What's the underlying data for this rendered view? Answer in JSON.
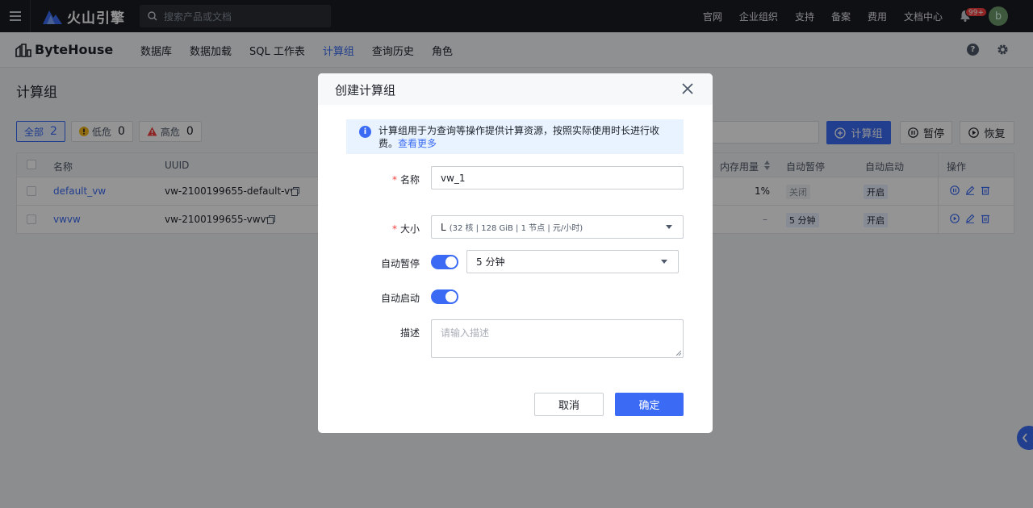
{
  "topbar": {
    "brand": "火山引擎",
    "search_placeholder": "搜索产品或文档",
    "links": [
      "官网",
      "企业组织",
      "支持",
      "备案",
      "费用",
      "文档中心"
    ],
    "notification_badge": "99+",
    "avatar_letter": "b"
  },
  "product": {
    "name": "ByteHouse",
    "tabs": [
      {
        "label": "数据库",
        "active": false
      },
      {
        "label": "数据加载",
        "active": false
      },
      {
        "label": "SQL 工作表",
        "active": false
      },
      {
        "label": "计算组",
        "active": true
      },
      {
        "label": "查询历史",
        "active": false
      },
      {
        "label": "角色",
        "active": false
      }
    ]
  },
  "page": {
    "title": "计算组",
    "filters": [
      {
        "label": "全部",
        "count": "2"
      },
      {
        "label": "低危",
        "count": "0"
      },
      {
        "label": "高危",
        "count": "0"
      }
    ],
    "actions": {
      "create": "计算组",
      "pause": "暂停",
      "resume": "恢复"
    }
  },
  "table": {
    "headers": {
      "name": "名称",
      "uuid": "UUID",
      "memory": "内存用量",
      "auto_pause": "自动暂停",
      "auto_start": "自动启动",
      "ops": "操作"
    },
    "rows": [
      {
        "name": "default_vw",
        "uuid": "vw-2100199655-default-vw",
        "memory": "1%",
        "auto_pause": "关闭",
        "auto_start": "开启"
      },
      {
        "name": "vwvw",
        "uuid": "vw-2100199655-vwvw",
        "memory": "–",
        "auto_pause": "5 分钟",
        "auto_start": "开启"
      }
    ]
  },
  "modal": {
    "title": "创建计算组",
    "info_text": "计算组用于为查询等操作提供计算资源，按照实际使用时长进行收费。",
    "info_link": "查看更多",
    "fields": {
      "name_label": "名称",
      "name_value": "vw_1",
      "size_label": "大小",
      "size_value": "L",
      "size_detail": "(32 核 | 128 GiB | 1 节点 | 元/小时)",
      "auto_pause_label": "自动暂停",
      "auto_pause_on": true,
      "auto_pause_value": "5 分钟",
      "auto_start_label": "自动启动",
      "auto_start_on": true,
      "desc_label": "描述",
      "desc_placeholder": "请输入描述"
    },
    "cancel": "取消",
    "confirm": "确定"
  },
  "colors": {
    "primary": "#3b6bf4",
    "danger": "#f53f3f",
    "topbar": "#1b1d22"
  }
}
